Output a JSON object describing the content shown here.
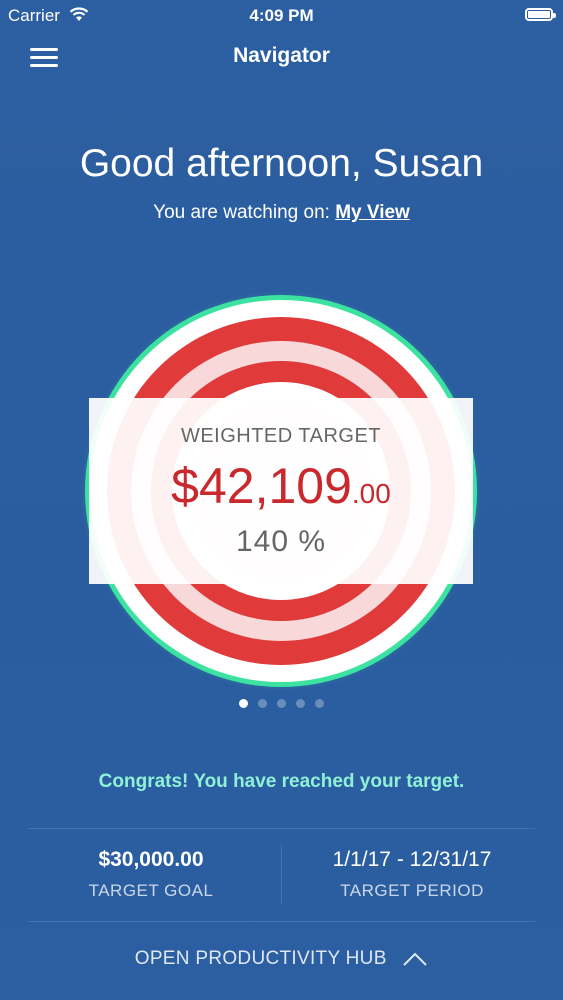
{
  "status_bar": {
    "carrier": "Carrier",
    "time": "4:09 PM"
  },
  "nav": {
    "title": "Navigator"
  },
  "greeting": "Good afternoon, Susan",
  "watching": {
    "prefix": "You are watching on: ",
    "view_link": "My View"
  },
  "target": {
    "label": "WEIGHTED TARGET",
    "amount": "$42,109",
    "cents": ".00",
    "percent": "140 %"
  },
  "pagination": {
    "count": 5,
    "active_index": 0
  },
  "congrats": "Congrats! You have reached your target.",
  "stats": [
    {
      "value": "$30,000.00",
      "label": "TARGET GOAL"
    },
    {
      "value": "1/1/17 - 12/31/17",
      "label": "TARGET PERIOD"
    }
  ],
  "hub": {
    "label": "OPEN PRODUCTIVITY HUB"
  },
  "colors": {
    "background": "#2a5b9c",
    "ring_green": "#3ce3a0",
    "ring_red": "#e03a3a",
    "ring_pink": "#f8d8d8",
    "amount_red": "#c9282d",
    "congrats": "#8ff0d6"
  },
  "icons": {
    "menu": "hamburger-icon",
    "wifi": "wifi-icon",
    "battery": "battery-icon",
    "hub_toggle": "chevron-up-icon"
  }
}
